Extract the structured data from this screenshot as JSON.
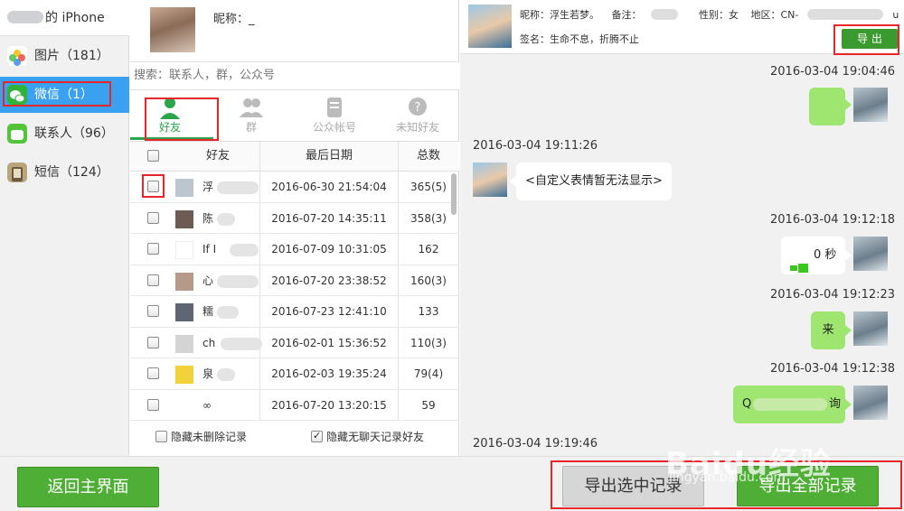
{
  "sidebar": {
    "device_suffix": "的 iPhone",
    "items": [
      {
        "label": "图片（181）",
        "icon": "photos-icon"
      },
      {
        "label": "微信（1）",
        "icon": "wechat-icon"
      },
      {
        "label": "联系人（96）",
        "icon": "contacts-icon"
      },
      {
        "label": "短信（124）",
        "icon": "sms-icon"
      }
    ]
  },
  "middle": {
    "nickname_label": "昵称：_",
    "search_placeholder": "搜索：联系人，群，公众号",
    "tabs": [
      {
        "label": "好友",
        "icon": "friend-icon"
      },
      {
        "label": "群",
        "icon": "group-icon"
      },
      {
        "label": "公众帐号",
        "icon": "official-account-icon"
      },
      {
        "label": "未知好友",
        "icon": "unknown-friend-icon"
      }
    ],
    "columns": {
      "friend": "好友",
      "last_date": "最后日期",
      "total": "总数"
    },
    "rows": [
      {
        "name": "浮",
        "date": "2016-06-30 21:54:04",
        "count": "365(5)"
      },
      {
        "name": "陈",
        "date": "2016-07-20 14:35:11",
        "count": "358(3)"
      },
      {
        "name": "If I",
        "date": "2016-07-09 10:31:05",
        "count": "162"
      },
      {
        "name": "心",
        "date": "2016-07-20 23:38:52",
        "count": "160(3)"
      },
      {
        "name": "糯",
        "date": "2016-07-23 12:41:10",
        "count": "133"
      },
      {
        "name": "ch",
        "date": "2016-02-01 15:36:52",
        "count": "110(3)"
      },
      {
        "name": "泉",
        "date": "2016-02-03 19:35:24",
        "count": "79(4)"
      },
      {
        "name": "∞",
        "date": "2016-07-20 13:20:15",
        "count": "59"
      }
    ],
    "hide_deleted": "隐藏未删除记录",
    "hide_no_chat": "隐藏无聊天记录好友"
  },
  "chat": {
    "header": {
      "nickname": "昵称：浮生若梦。",
      "remark": "备注：",
      "gender": "性别：女",
      "region": "地区：CN-",
      "region_tail": "u",
      "signature": "签名：生命不息，折腾不止",
      "export_label": "导 出"
    },
    "timestamps": [
      "2016-03-04 19:04:46",
      "2016-03-04 19:11:26",
      "2016-03-04 19:12:18",
      "2016-03-04 19:12:23",
      "2016-03-04 19:12:38",
      "2016-03-04 19:19:46"
    ],
    "messages": {
      "custom_emoji": "<自定义表情暂无法显示>",
      "voice": "0 秒",
      "text_lai": "来",
      "text_q_start": "Q",
      "text_q_end": "询"
    }
  },
  "bottom": {
    "back": "返回主界面",
    "export_selected": "导出选中记录",
    "export_all": "导出全部记录"
  },
  "watermark": {
    "brand": "Baidu经验",
    "url": "jingyan.baidu.com"
  }
}
